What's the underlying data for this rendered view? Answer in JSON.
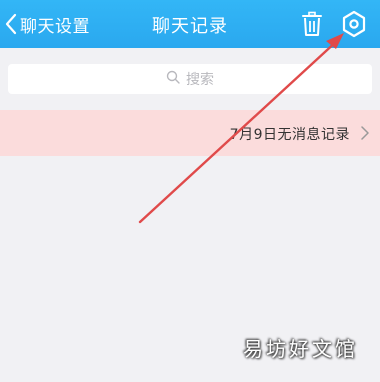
{
  "header": {
    "back_label": "聊天设置",
    "title": "聊天记录",
    "color": "#2fb0f3"
  },
  "icons": {
    "back": "chevron-left-icon",
    "trash": "trash-icon",
    "settings": "hexagon-gear-icon",
    "search": "search-icon",
    "chevron_right": "chevron-right-icon"
  },
  "search": {
    "placeholder": "搜索"
  },
  "notice": {
    "text": "7月9日无消息记录",
    "background": "#fbdcdc"
  },
  "annotation": {
    "arrow_color": "#e04a4a"
  },
  "watermark": {
    "text": "易坊好文馆"
  }
}
